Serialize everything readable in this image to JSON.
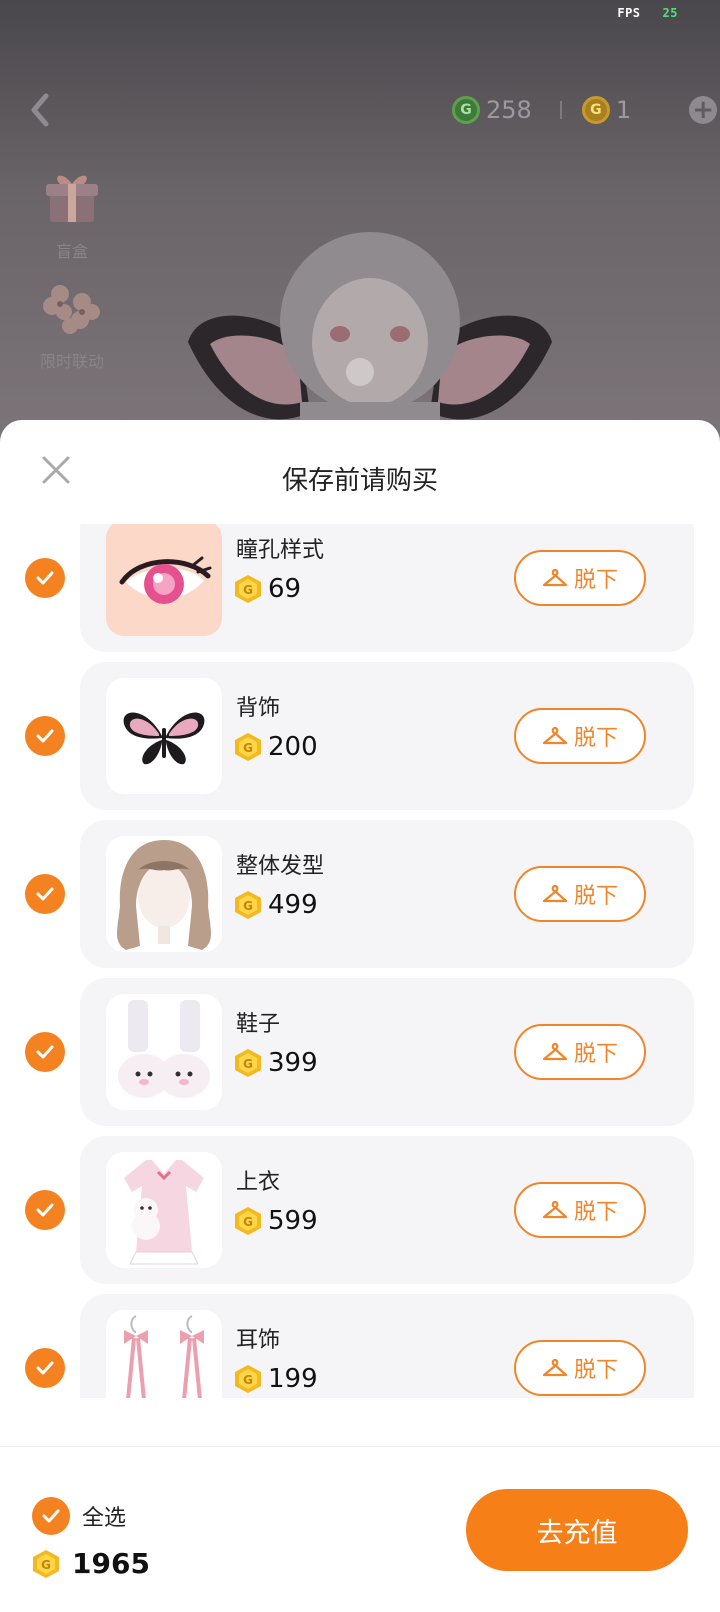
{
  "status": {
    "fps_label": "FPS",
    "fps_value": "25"
  },
  "header": {
    "back_icon": "chevron-left-icon",
    "currencies": [
      {
        "icon": "green-g-coin-icon",
        "value": "258"
      },
      {
        "icon": "gold-coin-icon",
        "value": "1"
      }
    ],
    "add_icon": "plus-circle-icon"
  },
  "side_menu": [
    {
      "icon": "gift-box-icon",
      "label": "盲盒"
    },
    {
      "icon": "sakura-flower-icon",
      "label": "限时联动"
    }
  ],
  "sheet": {
    "title": "保存前请购买",
    "close_icon": "close-icon",
    "items": [
      {
        "name": "瞳孔样式",
        "price": "69",
        "checked": true,
        "action": "脱下",
        "thumb": "eye-thumbnail"
      },
      {
        "name": "背饰",
        "price": "200",
        "checked": true,
        "action": "脱下",
        "thumb": "butterfly-thumbnail"
      },
      {
        "name": "整体发型",
        "price": "499",
        "checked": true,
        "action": "脱下",
        "thumb": "hair-thumbnail"
      },
      {
        "name": "鞋子",
        "price": "399",
        "checked": true,
        "action": "脱下",
        "thumb": "shoes-thumbnail"
      },
      {
        "name": "上衣",
        "price": "599",
        "checked": true,
        "action": "脱下",
        "thumb": "dress-thumbnail"
      },
      {
        "name": "耳饰",
        "price": "199",
        "checked": true,
        "action": "脱下",
        "thumb": "earring-thumbnail"
      }
    ]
  },
  "footer": {
    "select_all_label": "全选",
    "select_all_checked": true,
    "total": "1965",
    "recharge_label": "去充值"
  },
  "colors": {
    "accent": "#f58220",
    "button_bg": "#f77f18",
    "card_bg": "#f5f5f7"
  }
}
